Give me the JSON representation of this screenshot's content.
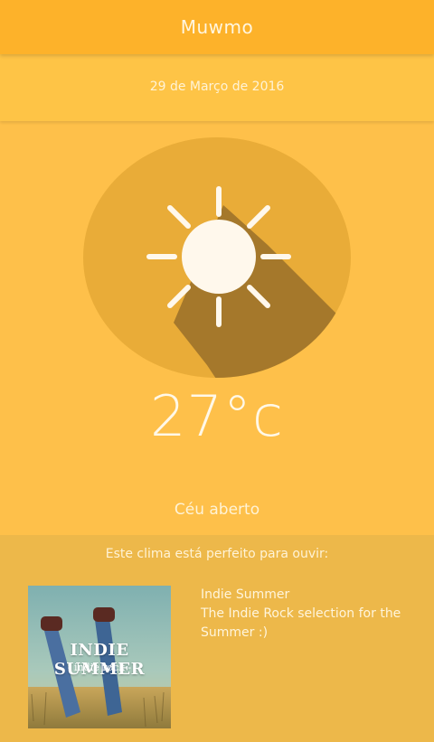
{
  "app": {
    "title": "Muwmo"
  },
  "date": "29 de Março de 2016",
  "weather": {
    "icon": "sun-icon",
    "temperature": "27°c",
    "condition": "Céu aberto"
  },
  "suggestion": {
    "label": "Este clima está perfeito para ouvir:",
    "album_art": {
      "title": "INDIE SUMMER",
      "subtitle": "- indie rock -"
    },
    "playlist_title": "Indie Summer",
    "playlist_description": "The Indie Rock selection for the Summer :)"
  },
  "colors": {
    "appbar": "#fdb22a",
    "background": "#fec04a",
    "circle": "#e9ac38",
    "shadow": "#a5782b",
    "sun": "#fff8ec"
  }
}
